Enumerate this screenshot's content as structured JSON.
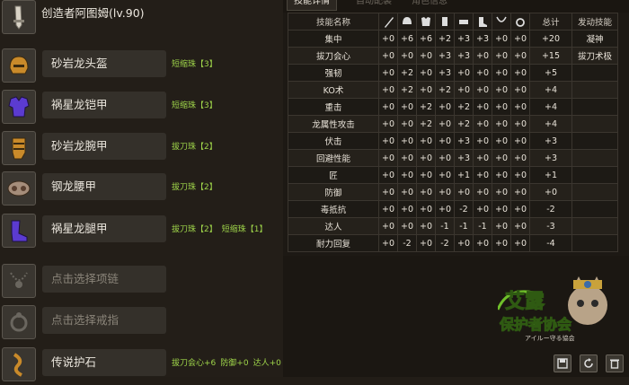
{
  "creator": {
    "label": "创造者阿图姆(lv.90)"
  },
  "equipment": [
    {
      "name": "砂岩龙头盔",
      "skills": [
        "短缩珠【3】"
      ],
      "icon": "helmet-icon",
      "color": "#c98a2a"
    },
    {
      "name": "祸星龙铠甲",
      "skills": [
        "短缩珠【3】"
      ],
      "icon": "chest-armor-icon",
      "color": "#5b3bd1"
    },
    {
      "name": "砂岩龙腕甲",
      "skills": [
        "拔刀珠【2】"
      ],
      "icon": "gauntlet-icon",
      "color": "#c98a2a"
    },
    {
      "name": "钢龙腰甲",
      "skills": [
        "拔刀珠【2】"
      ],
      "icon": "waist-armor-icon",
      "color": "#a58d7a"
    },
    {
      "name": "祸星龙腿甲",
      "skills": [
        "拔刀珠【2】",
        "短缩珠【1】"
      ],
      "icon": "leg-armor-icon",
      "color": "#5b3bd1"
    },
    {
      "name": "点击选择项链",
      "skills": [],
      "icon": "necklace-icon",
      "color": "#6a665f"
    },
    {
      "name": "点击选择戒指",
      "skills": [],
      "icon": "ring-icon",
      "color": "#6a665f"
    },
    {
      "name": "传说护石",
      "skills": [
        "拔刀会心+6",
        "防御+0",
        "达人+0"
      ],
      "icon": "charm-icon",
      "color": "#c98a2a"
    }
  ],
  "tabs": [
    "技能详情",
    "自动配装",
    "角色信息"
  ],
  "table": {
    "headers": {
      "skill": "技能名称",
      "total": "总计",
      "activated": "发动技能"
    },
    "slot_icons": [
      "weapon-icon",
      "helmet-icon",
      "chest-armor-icon",
      "gauntlet-icon",
      "waist-armor-icon",
      "leg-armor-icon",
      "necklace-icon",
      "ring-icon"
    ],
    "rows": [
      {
        "skill": "集中",
        "vals": [
          "+0",
          "+6",
          "+6",
          "+2",
          "+3",
          "+3",
          "+0",
          "+0"
        ],
        "total": "+20",
        "act": "凝神"
      },
      {
        "skill": "拔刀会心",
        "vals": [
          "+0",
          "+0",
          "+0",
          "+3",
          "+3",
          "+0",
          "+0",
          "+0"
        ],
        "total": "+15",
        "act": "拔刀术极"
      },
      {
        "skill": "强韧",
        "vals": [
          "+0",
          "+2",
          "+0",
          "+3",
          "+0",
          "+0",
          "+0",
          "+0"
        ],
        "total": "+5",
        "act": ""
      },
      {
        "skill": "KO术",
        "vals": [
          "+0",
          "+2",
          "+0",
          "+2",
          "+0",
          "+0",
          "+0",
          "+0"
        ],
        "total": "+4",
        "act": ""
      },
      {
        "skill": "重击",
        "vals": [
          "+0",
          "+0",
          "+2",
          "+0",
          "+2",
          "+0",
          "+0",
          "+0"
        ],
        "total": "+4",
        "act": ""
      },
      {
        "skill": "龙属性攻击",
        "vals": [
          "+0",
          "+0",
          "+2",
          "+0",
          "+2",
          "+0",
          "+0",
          "+0"
        ],
        "total": "+4",
        "act": ""
      },
      {
        "skill": "伏击",
        "vals": [
          "+0",
          "+0",
          "+0",
          "+0",
          "+3",
          "+0",
          "+0",
          "+0"
        ],
        "total": "+3",
        "act": ""
      },
      {
        "skill": "回避性能",
        "vals": [
          "+0",
          "+0",
          "+0",
          "+0",
          "+3",
          "+0",
          "+0",
          "+0"
        ],
        "total": "+3",
        "act": ""
      },
      {
        "skill": "匠",
        "vals": [
          "+0",
          "+0",
          "+0",
          "+0",
          "+1",
          "+0",
          "+0",
          "+0"
        ],
        "total": "+1",
        "act": ""
      },
      {
        "skill": "防御",
        "vals": [
          "+0",
          "+0",
          "+0",
          "+0",
          "+0",
          "+0",
          "+0",
          "+0"
        ],
        "total": "+0",
        "act": ""
      },
      {
        "skill": "毒抵抗",
        "vals": [
          "+0",
          "+0",
          "+0",
          "+0",
          "-2",
          "+0",
          "+0",
          "+0"
        ],
        "total": "-2",
        "act": ""
      },
      {
        "skill": "达人",
        "vals": [
          "+0",
          "+0",
          "+0",
          "-1",
          "-1",
          "-1",
          "+0",
          "+0"
        ],
        "total": "-3",
        "act": ""
      },
      {
        "skill": "耐力回复",
        "vals": [
          "+0",
          "-2",
          "+0",
          "-2",
          "+0",
          "+0",
          "+0",
          "+0"
        ],
        "total": "-4",
        "act": ""
      }
    ]
  },
  "logo": {
    "line1": "艾露",
    "line2": "保护者协会",
    "tagline": "アイルー守る協会"
  },
  "buttons": [
    "save-icon",
    "refresh-icon",
    "trash-icon"
  ]
}
